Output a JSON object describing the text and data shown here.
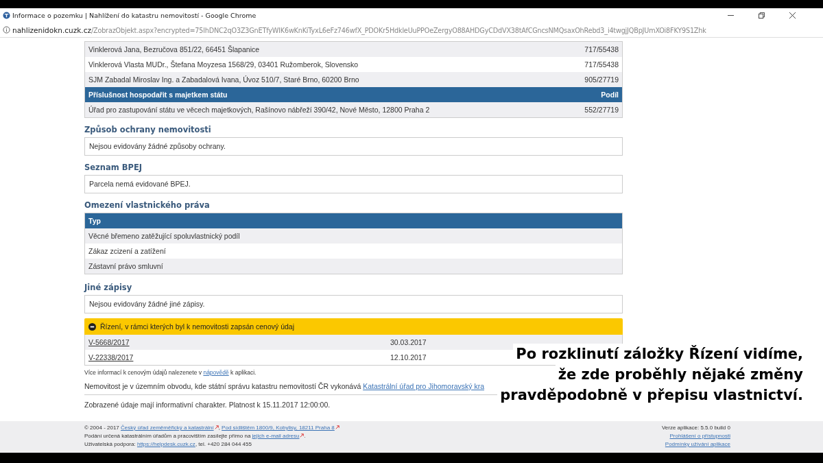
{
  "window": {
    "title": "Informace o pozemku | Nahlížení do katastru nemovitostí - Google Chrome"
  },
  "address_bar": {
    "domain": "nahlizenidokn.cuzk.cz",
    "path": "/ZobrazObjekt.aspx?encrypted=75lhDNC2qO3Z3GnETfyWIK6wKnKiTyxL6eFz746wfX_PDOKr5HdkleUuPPOeZergyO88AHDGyCDdVX38tAfCGncsNMQsaxOhRebd3_i4twgjJQBpJUmXOi8FKY9S1Zhk"
  },
  "owners": {
    "rows": [
      {
        "name": "Vinklerová Jana, Bezručova 851/22, 66451 Šlapanice",
        "share": "717/55438"
      },
      {
        "name": "Vinklerová Vlasta MUDr., Štefana Moyzesa 1568/29, 03401 Ružomberok, Slovensko",
        "share": "717/55438"
      },
      {
        "name": "SJM Zabadal Miroslav Ing. a Zabadalová Ivana, Úvoz 510/7, Staré Brno, 60200 Brno",
        "share": "905/27719"
      }
    ],
    "state_header": {
      "label": "Příslušnost hospodařit s majetkem státu",
      "share_label": "Podíl"
    },
    "state_rows": [
      {
        "name": "Úřad pro zastupování státu ve věcech majetkových, Rašínovo nábřeží 390/42, Nové Město, 12800 Praha 2",
        "share": "552/27719"
      }
    ]
  },
  "protection": {
    "heading": "Způsob ochrany nemovitosti",
    "text": "Nejsou evidovány žádné způsoby ochrany."
  },
  "bpej": {
    "heading": "Seznam BPEJ",
    "text": "Parcela nemá evidované BPEJ."
  },
  "restrictions": {
    "heading": "Omezení vlastnického práva",
    "column": "Typ",
    "rows": [
      "Věcné břemeno zatěžující spoluvlastnický podíl",
      "Zákaz zcizení a zatížení",
      "Zástavní právo smluvní"
    ]
  },
  "other_entries": {
    "heading": "Jiné zápisy",
    "text": "Nejsou evidovány žádné jiné zápisy."
  },
  "proceedings": {
    "title": "Řízení, v rámci kterých byl k nemovitosti zapsán cenový údaj",
    "expanded": true,
    "rows": [
      {
        "id": "V-5668/2017",
        "date": "30.03.2017"
      },
      {
        "id": "V-22338/2017",
        "date": "12.10.2017"
      }
    ]
  },
  "price_note": {
    "before": "Více informací k cenovým údajů nalezenete v ",
    "link": "nápovědě",
    "after": " k aplikaci."
  },
  "jurisdiction": {
    "before": "Nemovitost je v územním obvodu, kde státní správu katastru nemovitostí ČR vykonává ",
    "link": "Katastrální úřad pro Jihomoravský kra"
  },
  "validity": "Zobrazené údaje mají informativní charakter. Platnost k 15.11.2017 12:00:00.",
  "footer": {
    "left": [
      [
        {
          "kind": "text",
          "text": "© 2004 - 2017 "
        },
        {
          "kind": "link",
          "text": "Český úřad zeměměřický a katastrální",
          "external": true
        },
        {
          "kind": "text",
          "text": ", "
        },
        {
          "kind": "link",
          "text": "Pod sídlištěm 1800/9, Kobylisy, 18211 Praha 8",
          "external": true
        }
      ],
      [
        {
          "kind": "text",
          "text": "Podání určená katastrálním úřadům a pracovištím zasílejte přímo na "
        },
        {
          "kind": "link",
          "text": "jejich e-mail adresu",
          "external": true
        },
        {
          "kind": "text",
          "text": "."
        }
      ],
      [
        {
          "kind": "text",
          "text": "Uživatelská podpora: "
        },
        {
          "kind": "link",
          "text": "https://helpdesk.cuzk.cz",
          "external": false
        },
        {
          "kind": "text",
          "text": ", tel. +420 284 044 455"
        }
      ]
    ],
    "version": "Verze aplikace: 5.5.0 build 0",
    "links": [
      "Prohlášení o přístupnosti",
      "Podmínky užívání aplikace"
    ]
  },
  "caption": [
    "Po rozklinutí záložky Řízení vidíme,",
    "že zde proběhly nějaké změny",
    "pravděpodobně v přepisu vlastnictví."
  ]
}
